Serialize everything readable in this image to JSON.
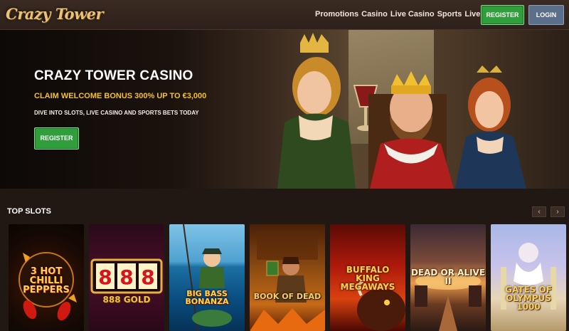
{
  "header": {
    "logo": "Crazy Tower",
    "nav": [
      "Promotions",
      "Casino",
      "Live Casino",
      "Sports",
      "Live Betting"
    ],
    "register_label": "REGISTER",
    "login_label": "LOGIN"
  },
  "hero": {
    "title": "CRAZY TOWER CASINO",
    "bonus": "CLAIM WELCOME BONUS 300% UP TO €3,000",
    "subtitle": "DIVE INTO SLOTS, LIVE CASINO AND SPORTS BETS TODAY",
    "register_label": "REGISTER"
  },
  "top_slots": {
    "title": "TOP SLOTS",
    "prev_arrow": "‹",
    "next_arrow": "›",
    "games": [
      {
        "name": "3 HOT CHILLI PEPPERS"
      },
      {
        "name": "888 GOLD"
      },
      {
        "name": "BIG BASS BONANZA"
      },
      {
        "name": "BOOK OF DEAD"
      },
      {
        "name": "BUFFALO KING MEGAWAYS"
      },
      {
        "name": "DEAD OR ALIVE II"
      },
      {
        "name": "GATES OF OLYMPUS 1000"
      }
    ]
  },
  "colors": {
    "accent_green": "#2f9e3b",
    "login_blue": "#5b6e8a",
    "bonus_yellow": "#f2c12e",
    "background": "#211814"
  }
}
